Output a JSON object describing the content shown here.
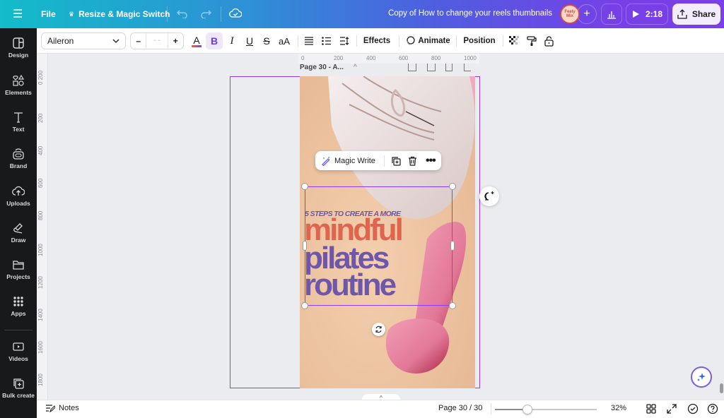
{
  "topbar": {
    "file_label": "File",
    "resize_label": "Resize & Magic Switch",
    "doc_title": "Copy of How to change your reels thumbnails",
    "avatar_text": "Feely Mix",
    "play_time": "2:18",
    "share_label": "Share"
  },
  "toolbar": {
    "font_name": "Aileron",
    "font_size_placeholder": "- -",
    "minus": "–",
    "plus": "+",
    "bold": "B",
    "italic": "I",
    "underline": "U",
    "strike": "S",
    "case": "aA",
    "effects_label": "Effects",
    "animate_label": "Animate",
    "position_label": "Position",
    "text_color": "#e0654f"
  },
  "sidebar": {
    "items": [
      {
        "label": "Design",
        "icon": "design-icon"
      },
      {
        "label": "Elements",
        "icon": "elements-icon"
      },
      {
        "label": "Text",
        "icon": "text-icon"
      },
      {
        "label": "Brand",
        "icon": "brand-icon"
      },
      {
        "label": "Uploads",
        "icon": "uploads-icon"
      },
      {
        "label": "Draw",
        "icon": "draw-icon"
      },
      {
        "label": "Projects",
        "icon": "projects-icon"
      },
      {
        "label": "Apps",
        "icon": "apps-icon"
      },
      {
        "label": "Videos",
        "icon": "videos-icon"
      },
      {
        "label": "Bulk create",
        "icon": "bulk-create-icon"
      }
    ]
  },
  "rulers": {
    "top": [
      "0",
      "200",
      "400",
      "600",
      "800",
      "1000"
    ],
    "left": [
      "0 200",
      "200",
      "400",
      "600",
      "800",
      "1000",
      "1200",
      "1400",
      "1600",
      "1800"
    ]
  },
  "page_header": {
    "label": "Page 30 - A..."
  },
  "floating_menu": {
    "magic_write_label": "Magic Write"
  },
  "design": {
    "subtitle": "5 STEPS TO CREATE A MORE",
    "line1": "mindful",
    "line2": "pilates",
    "line3": "routine",
    "color_accent": "#e0654f",
    "color_primary": "#6e57a8"
  },
  "bottombar": {
    "notes_label": "Notes",
    "page_indicator": "Page 30 / 30",
    "zoom_level": "32%",
    "zoom_fraction": 0.32
  }
}
